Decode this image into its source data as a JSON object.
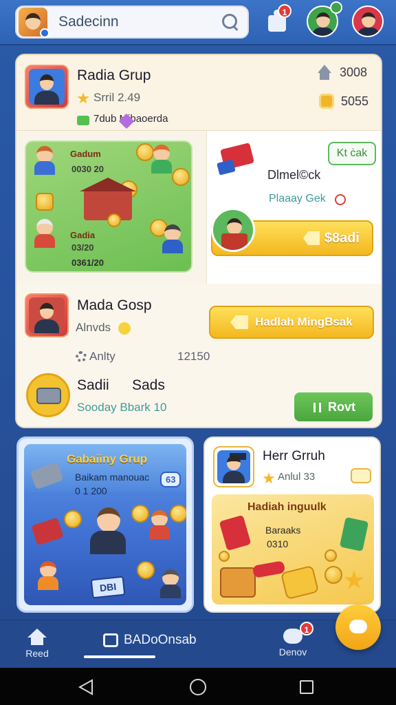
{
  "search": {
    "value": "Sadecinn"
  },
  "topbar": {
    "puzzle_badge": "1"
  },
  "card_top": {
    "title": "Radia Grup",
    "rating": "Srril 2.49",
    "tags": "7dub Mibaoerda",
    "stat_home": "3008",
    "stat_coin": "5055"
  },
  "card_mid": {
    "art_label_1": "Gadum",
    "art_value_1": "0030 20",
    "art_label_2": "Gadia",
    "art_value_2": "03/20",
    "art_value_3": "0361/20",
    "kb_button": "Kt ċak",
    "title": "Dlmel©ck",
    "subtitle": "Plaaay Gek",
    "claim_button": "$8adi"
  },
  "card_row3": {
    "title": "Mada Gosp",
    "subtitle": "Alnvds",
    "action_button": "Hadlah MingBsak",
    "meta_left": "Anlty",
    "meta_right": "12150",
    "item_title": "Sadii",
    "item_title_2": "Sads",
    "item_subtitle": "Sooday Bbark 10",
    "rout_button": "Rovt"
  },
  "card_a": {
    "title": "Gabaiiny Grup",
    "line1": "Baikam manouac",
    "line2": "0 1 200",
    "chip": "63",
    "ticket": "DBI"
  },
  "card_b": {
    "title": "Herr Grruh",
    "rating": "Anlul 33",
    "art_title": "Hadiah inguulk",
    "art_line1": "Baraaks",
    "art_line2": "0310"
  },
  "nav": {
    "home_label": "Reed",
    "center_label": "BADoOnsab",
    "chat_label": "Denov",
    "chat_badge": "1"
  },
  "colors": {
    "primary_blue": "#2a5aa8",
    "accent_yellow": "#f3b720",
    "accent_green": "#4aa63d",
    "badge_red": "#e23a3a"
  }
}
